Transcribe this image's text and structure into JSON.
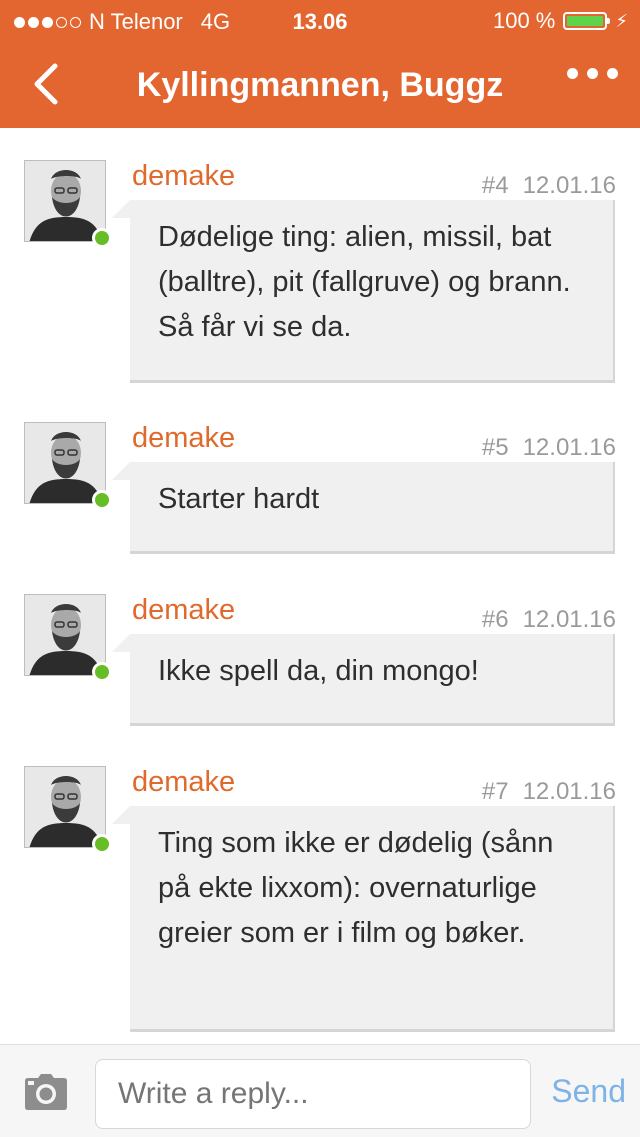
{
  "status_bar": {
    "carrier": "N Telenor",
    "network": "4G",
    "time": "13.06",
    "battery": "100 %",
    "battery_level": 1.0
  },
  "nav": {
    "title": "Kyllingmannen, Buggz",
    "back_icon": "chevron-left-icon",
    "more_icon": "ellipsis-icon"
  },
  "messages": [
    {
      "author": "demake",
      "number": "#4",
      "date": "12.01.16",
      "text": "Dødelige ting: alien, missil, bat (balltre), pit (fallgruve) og brann. Så får vi se da."
    },
    {
      "author": "demake",
      "number": "#5",
      "date": "12.01.16",
      "text": "Starter hardt"
    },
    {
      "author": "demake",
      "number": "#6",
      "date": "12.01.16",
      "text": "Ikke spell da, din mongo!"
    },
    {
      "author": "demake",
      "number": "#7",
      "date": "12.01.16",
      "text": "Ting som ikke er dødelig (sånn på ekte lixxom): overnaturlige greier som er i film og bøker."
    }
  ],
  "composer": {
    "placeholder": "Write a reply...",
    "send_label": "Send",
    "camera_icon": "camera-icon"
  },
  "colors": {
    "brand": "#e36530",
    "author": "#df6a2b",
    "online": "#67bd26",
    "send": "#7fb2e6"
  }
}
